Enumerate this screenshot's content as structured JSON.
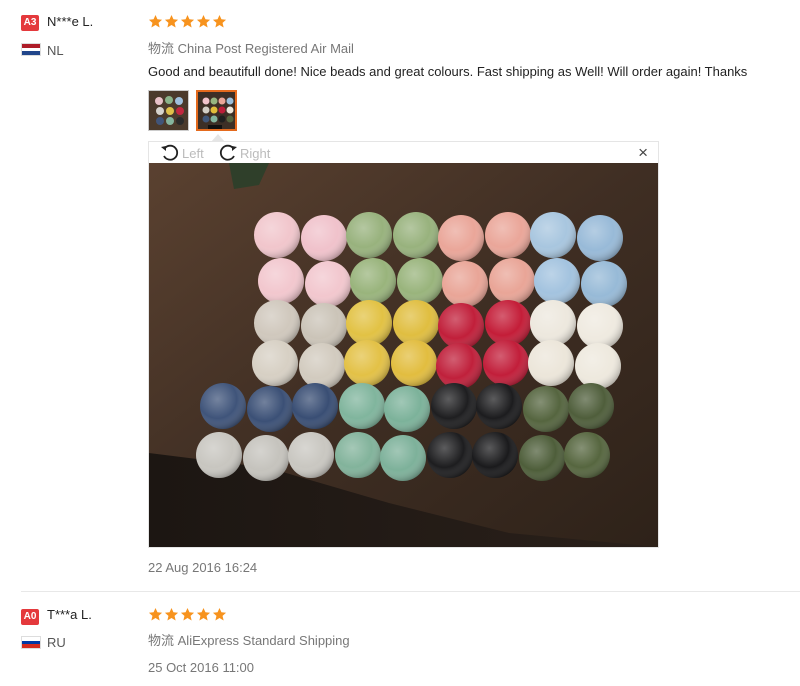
{
  "reviews": [
    {
      "badge": "A3",
      "badge_color": "#e4393c",
      "username": "N***e L.",
      "country": "NL",
      "flag_colors": [
        "#ae1c28",
        "#ffffff",
        "#21468b"
      ],
      "stars": 5,
      "shipping_prefix": "物流",
      "shipping": "China Post Registered Air Mail",
      "text": "Good and beautifull done! Nice beads and great colours. Fast shipping as Well! Will order again! Thanks",
      "photo_count": 2,
      "date": "22 Aug 2016 16:24"
    },
    {
      "badge": "A0",
      "badge_color": "#e4393c",
      "username": "T***a L.",
      "country": "RU",
      "flag_colors": [
        "#ffffff",
        "#0039a6",
        "#d52b1e"
      ],
      "stars": 5,
      "shipping_prefix": "物流",
      "shipping": "AliExpress Standard Shipping",
      "date": "25 Oct 2016 11:00"
    }
  ],
  "viewer": {
    "rotate_left": "Left",
    "rotate_right": "Right",
    "close": "×"
  },
  "colors": {
    "star": "#f7931e",
    "active_thumb_border": "#e46a1d"
  },
  "icons": [
    "rotate-left-icon",
    "rotate-right-icon",
    "close-icon",
    "star-icon"
  ]
}
